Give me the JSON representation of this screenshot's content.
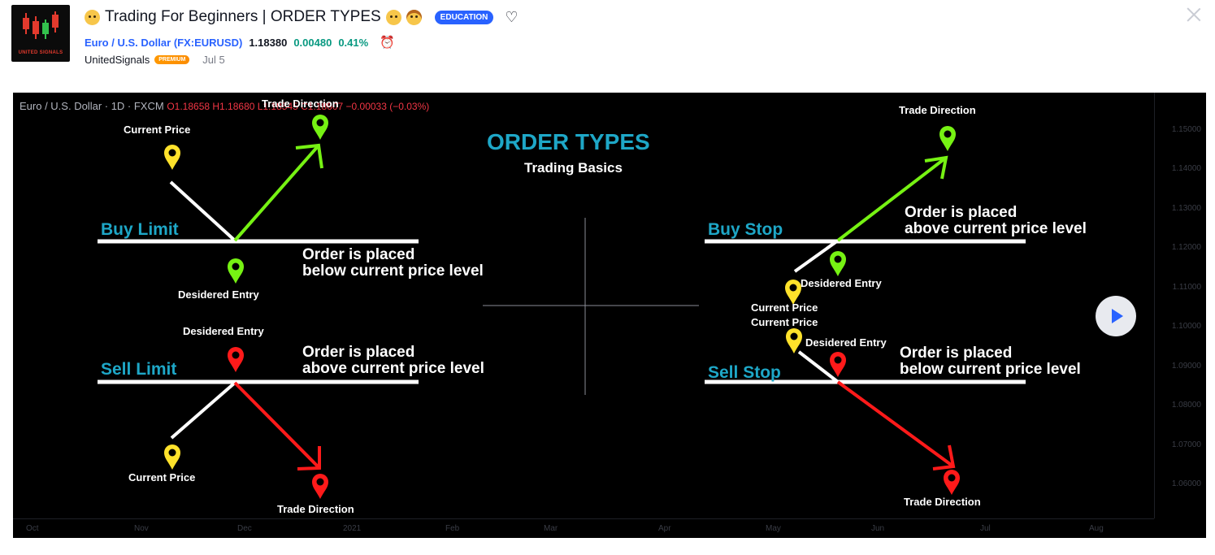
{
  "header": {
    "title": "Trading For Beginners | ORDER TYPES",
    "badge": "EDUCATION",
    "logo_text": "UNITED SIGNALS",
    "symbol_name": "Euro / U.S. Dollar",
    "symbol_ticker": "(FX:EURUSD)",
    "price": "1.18380",
    "change": "0.00480",
    "change_pct": "0.41%",
    "author": "UnitedSignals",
    "author_badge": "PREMIUM",
    "date": "Jul 5"
  },
  "chart": {
    "ohlc_prefix": "Euro / U.S. Dollar · 1D · FXCM",
    "ohlc_values": "O1.18658 H1.18680 L1.18545 C1.18607 −0.00033 (−0.03%)",
    "y_ticks": [
      "1.15000",
      "1.14000",
      "1.13000",
      "1.12000",
      "1.11000",
      "1.10000",
      "1.09000",
      "1.08000",
      "1.07000",
      "1.06000"
    ],
    "x_ticks": [
      "Oct",
      "Nov",
      "Dec",
      "2021",
      "Feb",
      "Mar",
      "Apr",
      "May",
      "Jun",
      "Jul",
      "Aug"
    ],
    "colors": {
      "accent": "#1ea7c7",
      "green": "#76f213",
      "red": "#ff1a1a",
      "yellow": "#ffe22b"
    }
  },
  "annotations": {
    "main_title": "ORDER TYPES",
    "subtitle": "Trading Basics",
    "buy_limit": {
      "name": "Buy Limit",
      "current_price": "Current Price",
      "entry": "Desidered Entry",
      "direction": "Trade Direction",
      "desc_line1": "Order is placed",
      "desc_line2": "below current price level"
    },
    "sell_limit": {
      "name": "Sell Limit",
      "current_price": "Current Price",
      "entry": "Desidered Entry",
      "direction": "Trade Direction",
      "desc_line1": "Order is placed",
      "desc_line2": "above current price level"
    },
    "buy_stop": {
      "name": "Buy Stop",
      "current_price": "Current Price",
      "entry": "Desidered Entry",
      "direction": "Trade Direction",
      "desc_line1": "Order is placed",
      "desc_line2": "above current price level"
    },
    "sell_stop": {
      "name": "Sell Stop",
      "current_price": "Current Price",
      "entry": "Desidered Entry",
      "direction": "Trade Direction",
      "desc_line1": "Order is placed",
      "desc_line2": "below current price level"
    }
  }
}
